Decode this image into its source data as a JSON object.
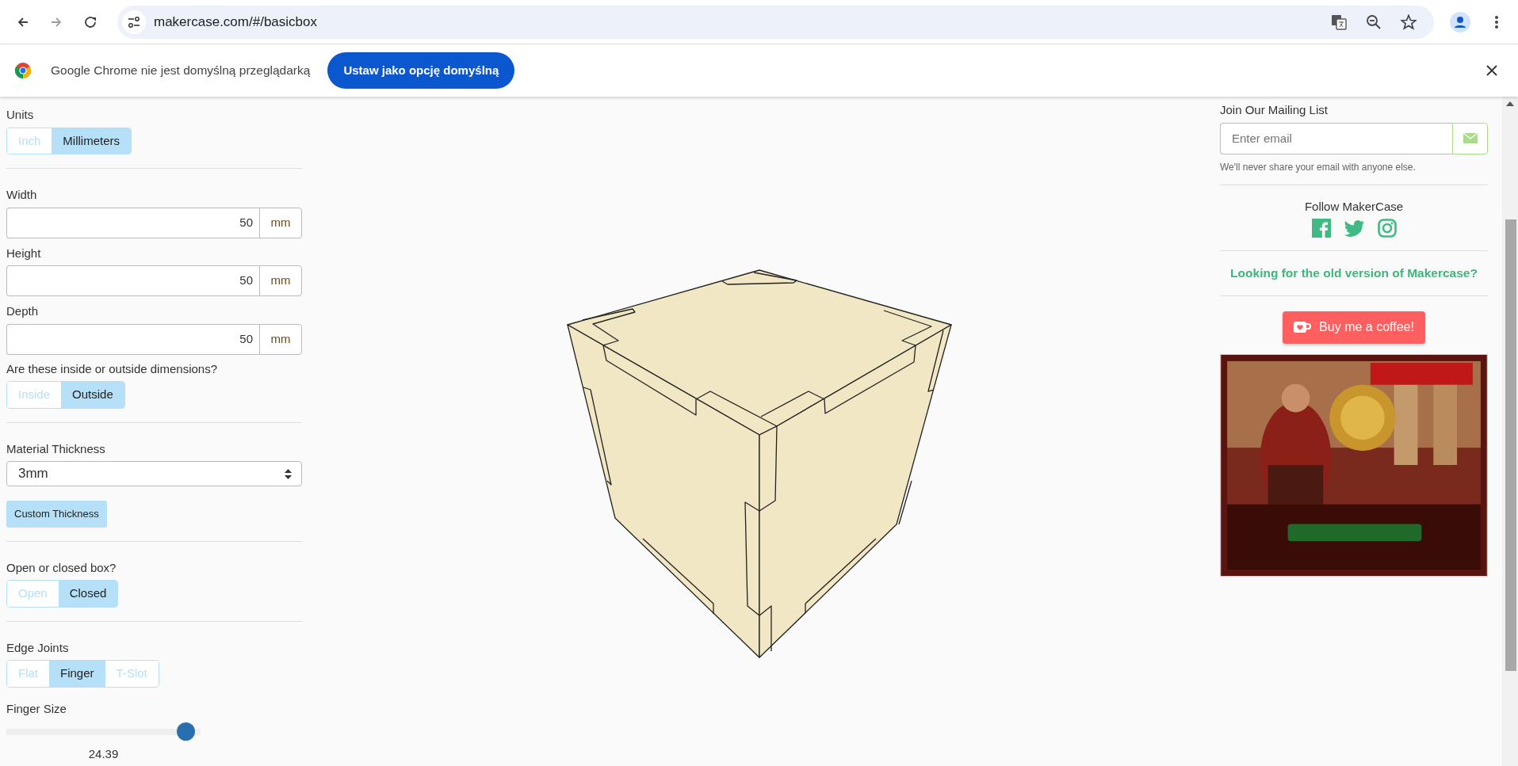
{
  "browser": {
    "url": "makercase.com/#/basicbox",
    "nav": [
      {
        "kind": "back",
        "disabled": false
      },
      {
        "kind": "forward",
        "disabled": true
      },
      {
        "kind": "reload",
        "disabled": false
      }
    ]
  },
  "infobar": {
    "message": "Google Chrome nie jest domyślną przeglądarką",
    "button": "Ustaw jako opcję domyślną"
  },
  "groups": [
    [
      {
        "kind": "toggle",
        "label": "Units",
        "options": [
          {
            "label": "Inch",
            "selected": false
          },
          {
            "label": "Millimeters",
            "selected": true
          }
        ]
      }
    ],
    [
      {
        "kind": "number",
        "label": "Width",
        "value": "50",
        "unit": "mm"
      },
      {
        "kind": "number",
        "label": "Height",
        "value": "50",
        "unit": "mm"
      },
      {
        "kind": "number",
        "label": "Depth",
        "value": "50",
        "unit": "mm"
      },
      {
        "kind": "toggle",
        "label": "Are these inside or outside dimensions?",
        "options": [
          {
            "label": "Inside",
            "selected": false
          },
          {
            "label": "Outside",
            "selected": true
          }
        ]
      }
    ],
    [
      {
        "kind": "select",
        "label": "Material Thickness",
        "value": "3mm"
      },
      {
        "kind": "button",
        "label": "Custom Thickness"
      }
    ],
    [
      {
        "kind": "toggle",
        "label": "Open or closed box?",
        "options": [
          {
            "label": "Open",
            "selected": false
          },
          {
            "label": "Closed",
            "selected": true
          }
        ]
      }
    ],
    [
      {
        "kind": "toggle",
        "label": "Edge Joints",
        "options": [
          {
            "label": "Flat",
            "selected": false
          },
          {
            "label": "Finger",
            "selected": true
          },
          {
            "label": "T-Slot",
            "selected": false
          }
        ]
      },
      {
        "kind": "slider",
        "label": "Finger Size",
        "level": 0.97,
        "reading": "24.39"
      }
    ]
  ],
  "mailing": {
    "title": "Join Our Mailing List",
    "placeholder": "Enter email",
    "note": "We'll never share your email with anyone else."
  },
  "follow": {
    "title": "Follow MakerCase",
    "networks": [
      {
        "kind": "facebook"
      },
      {
        "kind": "twitter"
      },
      {
        "kind": "instagram"
      }
    ]
  },
  "old_version_link": "Looking for the old version of Makercase?",
  "coffee_button": "Buy me a coffee!",
  "ad": {
    "kind": "picture"
  }
}
